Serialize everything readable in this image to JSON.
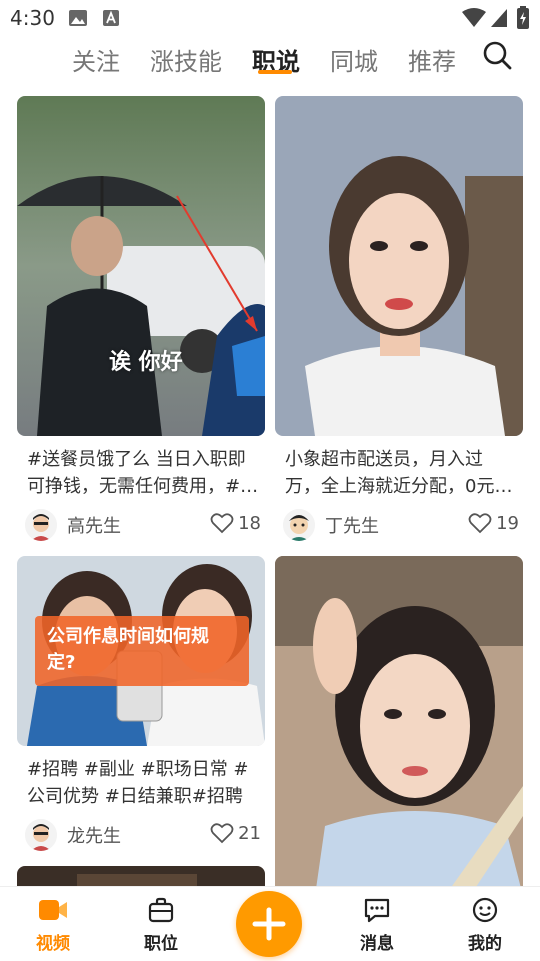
{
  "status_bar": {
    "time": "4:30"
  },
  "top_tabs": [
    {
      "label": "关注",
      "active": false
    },
    {
      "label": "涨技能",
      "active": false
    },
    {
      "label": "职说",
      "active": true
    },
    {
      "label": "同城",
      "active": false
    },
    {
      "label": "推荐",
      "active": false
    }
  ],
  "cards": [
    {
      "title": "#送餐员饿了么 当日入职即可挣钱，无需任何费用，#…",
      "author": "高先生",
      "likes": "18",
      "overlay_text": "诶 你好"
    },
    {
      "title": "小象超市配送员，月入过万，全上海就近分配，0元…",
      "author": "丁先生",
      "likes": "19"
    },
    {
      "title": "#招聘 #副业 #职场日常 #公司优势 #日结兼职#招聘",
      "author": "龙先生",
      "likes": "21",
      "overlay_text": "公司作息时间如何规定?"
    },
    {
      "title": "",
      "author": "",
      "likes": ""
    }
  ],
  "bottom_nav": [
    {
      "label": "视频",
      "active": true,
      "icon": "video-icon"
    },
    {
      "label": "职位",
      "active": false,
      "icon": "briefcase-icon"
    },
    {
      "label": "",
      "active": false,
      "icon": "plus-icon"
    },
    {
      "label": "消息",
      "active": false,
      "icon": "message-icon"
    },
    {
      "label": "我的",
      "active": false,
      "icon": "profile-icon"
    }
  ],
  "colors": {
    "accent": "#ff8a00",
    "text": "#222222",
    "muted": "#777777"
  }
}
